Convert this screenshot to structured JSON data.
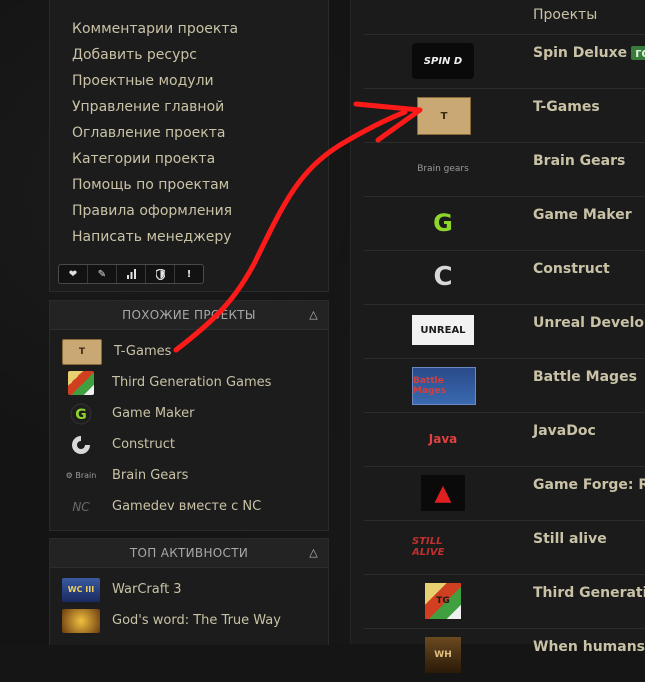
{
  "menu": {
    "items": [
      "Комментарии проекта",
      "Добавить ресурс",
      "Проектные модули",
      "Управление главной",
      "Оглавление проекта",
      "Категории проекта",
      "Помощь по проектам",
      "Правила оформления",
      "Написать менеджеру"
    ]
  },
  "similar": {
    "title": "ПОХОЖИЕ ПРОЕКТЫ",
    "items": [
      "T-Games",
      "Third Generation Games",
      "Game Maker",
      "Construct",
      "Brain Gears",
      "Gamedev вместе с NC"
    ]
  },
  "top_activity": {
    "title": "ТОП АКТИВНОСТИ",
    "items": [
      "WarCraft 3",
      "God's word: The True Way"
    ]
  },
  "right": {
    "header_label": "Проекты",
    "badge": "гото",
    "projects": [
      {
        "name": "Spin Deluxe",
        "logo": "SPIN D"
      },
      {
        "name": "T-Games",
        "logo": "T"
      },
      {
        "name": "Brain Gears",
        "logo": "Brain gears"
      },
      {
        "name": "Game Maker",
        "logo": "G"
      },
      {
        "name": "Construct",
        "logo": "C"
      },
      {
        "name": "Unreal Developm",
        "logo": "UNREAL"
      },
      {
        "name": "Battle Mages",
        "logo": "Battle Mages"
      },
      {
        "name": "JavaDoc",
        "logo": "Java"
      },
      {
        "name": "Game Forge: Ref",
        "logo": "▲"
      },
      {
        "name": "Still alive",
        "logo": "STILL ALIVE"
      },
      {
        "name": "Third Generation",
        "logo": "TG"
      },
      {
        "name": "When humans ar",
        "logo": "WH"
      }
    ]
  },
  "colors": {
    "text": "#c9c2a6",
    "arrow": "#ff1a1a",
    "badge": "#3a7a3a"
  }
}
